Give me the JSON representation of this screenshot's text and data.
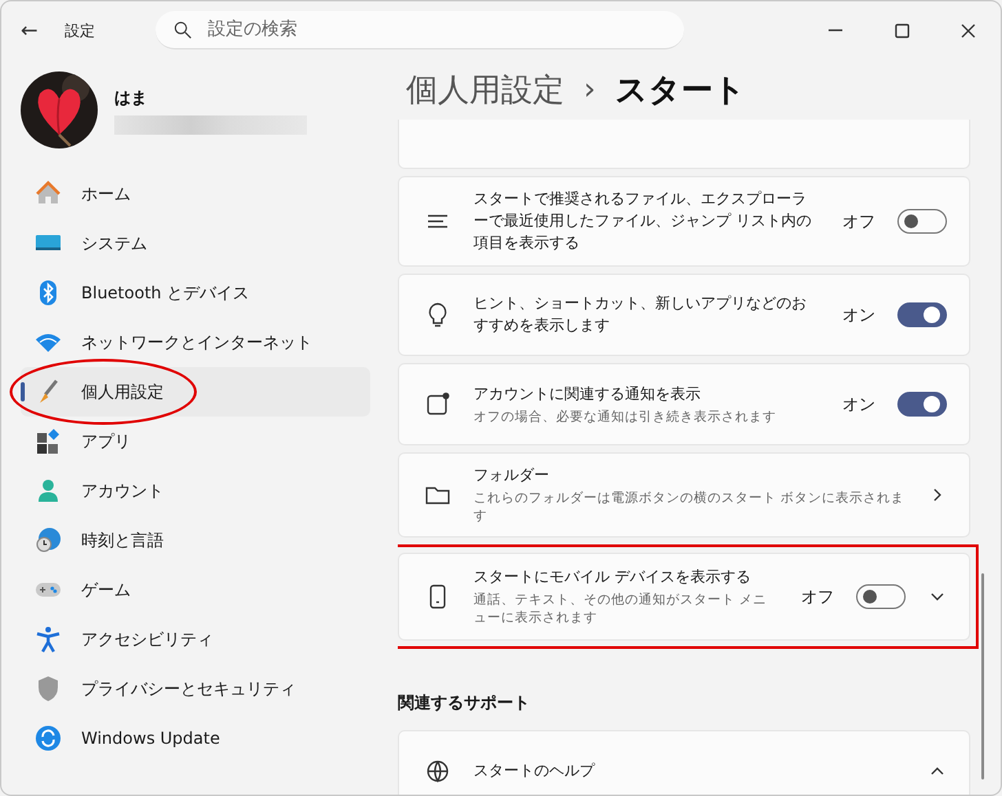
{
  "window": {
    "title": "設定",
    "back": "←"
  },
  "search": {
    "placeholder": "設定の検索"
  },
  "user": {
    "name": "はま"
  },
  "sidebar": {
    "items": [
      {
        "label": "ホーム",
        "selected": false,
        "circled": false
      },
      {
        "label": "システム",
        "selected": false,
        "circled": false
      },
      {
        "label": "Bluetooth とデバイス",
        "selected": false,
        "circled": false
      },
      {
        "label": "ネットワークとインターネット",
        "selected": false,
        "circled": false
      },
      {
        "label": "個人用設定",
        "selected": true,
        "circled": true
      },
      {
        "label": "アプリ",
        "selected": false,
        "circled": false
      },
      {
        "label": "アカウント",
        "selected": false,
        "circled": false
      },
      {
        "label": "時刻と言語",
        "selected": false,
        "circled": false
      },
      {
        "label": "ゲーム",
        "selected": false,
        "circled": false
      },
      {
        "label": "アクセシビリティ",
        "selected": false,
        "circled": false
      },
      {
        "label": "プライバシーとセキュリティ",
        "selected": false,
        "circled": false
      },
      {
        "label": "Windows Update",
        "selected": false,
        "circled": false
      }
    ]
  },
  "breadcrumb": {
    "parent": "個人用設定",
    "separator": "›",
    "current": "スタート"
  },
  "settings": [
    {
      "kind": "fragment"
    },
    {
      "kind": "toggle",
      "title": "スタートで推奨されるファイル、エクスプローラーで最近使用したファイル、ジャンプ リスト内の項目を表示する",
      "state_label": "オフ",
      "on": false,
      "highlighted": false
    },
    {
      "kind": "toggle",
      "title": "ヒント、ショートカット、新しいアプリなどのおすすめを表示します",
      "state_label": "オン",
      "on": true,
      "highlighted": false
    },
    {
      "kind": "toggle",
      "title": "アカウントに関連する通知を表示",
      "description": "オフの場合、必要な通知は引き続き表示されます",
      "state_label": "オン",
      "on": true,
      "highlighted": false
    },
    {
      "kind": "link",
      "title": "フォルダー",
      "description": "これらのフォルダーは電源ボタンの横のスタート ボタンに表示されます",
      "highlighted": false
    },
    {
      "kind": "expander",
      "title": "スタートにモバイル デバイスを表示する",
      "description": "通話、テキスト、その他の通知がスタート メニューに表示されます",
      "state_label": "オフ",
      "on": false,
      "expanded": false,
      "highlighted": true
    }
  ],
  "related": {
    "heading": "関連するサポート",
    "items": [
      {
        "title": "スタートのヘルプ",
        "expanded": true
      }
    ]
  }
}
